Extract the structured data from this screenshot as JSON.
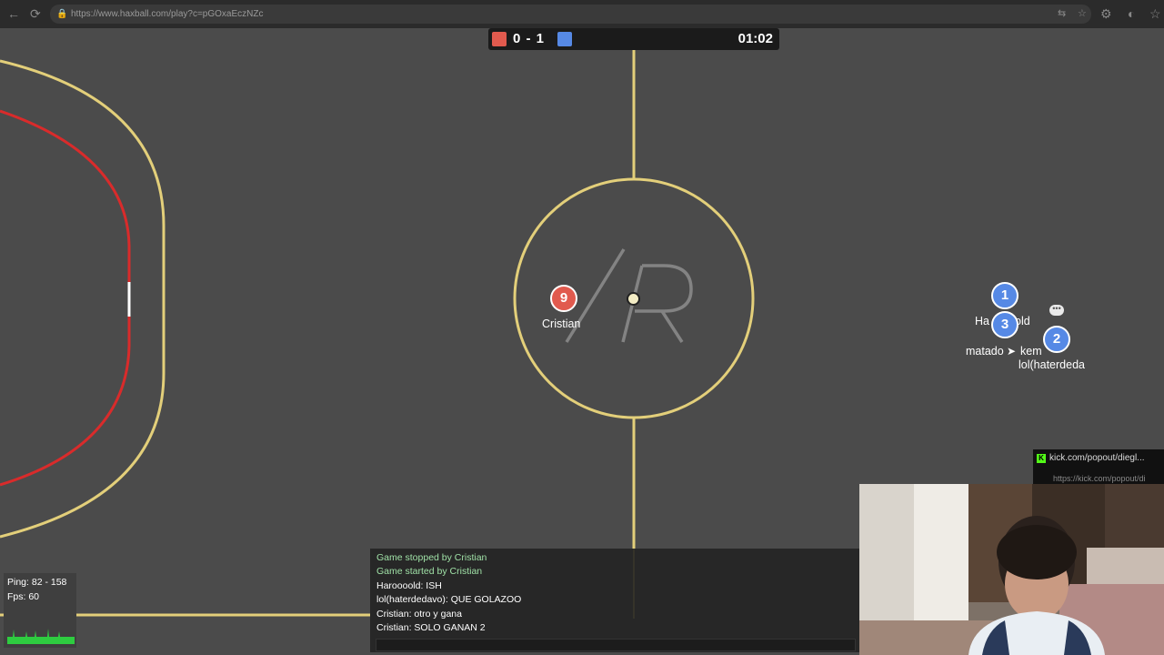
{
  "browser": {
    "url": "https://www.haxball.com/play?c=pGOxaEczNZc",
    "icons": [
      "back-icon",
      "reload-icon",
      "lock-icon",
      "translate-icon",
      "star-icon",
      "extensions-icon",
      "profile-icon",
      "favorites-icon"
    ]
  },
  "scoreboard": {
    "red_score": 0,
    "blue_score": 1,
    "score_text": "0 - 1",
    "time": "01:02",
    "red_color": "#e15a4e",
    "blue_color": "#5689e5"
  },
  "players": [
    {
      "number": "9",
      "name": "Cristian",
      "team": "red"
    },
    {
      "number": "1",
      "name": "Haroooold",
      "team": "blue"
    },
    {
      "number": "3",
      "name": "matador",
      "team": "blue"
    },
    {
      "number": "2",
      "name": "lol(haterdedavo)",
      "team": "blue"
    }
  ],
  "player_labels": {
    "cristian": "Cristian",
    "haroooold": "Ha",
    "haroooold_tail": "old",
    "matador": "matado",
    "kem": "kem",
    "lol": "lol(haterdeda"
  },
  "chat": {
    "messages": [
      {
        "text": "Game stopped by Cristian",
        "system": true
      },
      {
        "text": "Game started by Cristian",
        "system": true
      },
      {
        "text": "Haroooold: ISH",
        "system": false
      },
      {
        "text": "lol(haterdedavo): QUE GOLAZOO",
        "system": false
      },
      {
        "text": "Cristian: otro y gana",
        "system": false
      },
      {
        "text": "Cristian: SOLO GANAN 2",
        "system": false
      }
    ]
  },
  "stats": {
    "ping": "Ping: 82 - 158",
    "fps": "Fps: 60"
  },
  "overlay": {
    "kick_title": "kick.com/popout/diegl...",
    "kick_url": "https://kick.com/popout/di"
  },
  "colors": {
    "field": "#4b4b4b",
    "lines": "#e3cf7a",
    "goal_area": "#d92b2b",
    "red_team": "#e15a4e",
    "blue_team": "#5689e5"
  }
}
